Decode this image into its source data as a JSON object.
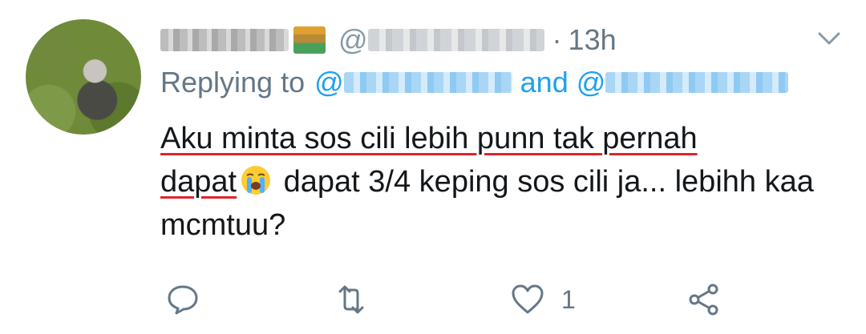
{
  "tweet": {
    "header": {
      "handle_prefix": "@",
      "separator": "·",
      "time": "13h"
    },
    "reply": {
      "prefix": "Replying to",
      "mention_prefix_1": "@",
      "conjunction": "and",
      "mention_prefix_2": "@"
    },
    "body": {
      "underlined_1": "Aku minta sos cili lebih punn tak pernah",
      "underlined_2": "dapat",
      "rest": " dapat 3/4 keping sos cili ja... lebihh kaa mcmtuu?"
    },
    "actions": {
      "like_count": "1"
    }
  },
  "icons": {
    "more": "chevron-down-icon",
    "reply": "reply-icon",
    "retweet": "retweet-icon",
    "like": "heart-icon",
    "share": "share-icon",
    "emoji": "loudly-crying-face-icon"
  },
  "colors": {
    "link": "#1da1f2",
    "muted": "#657786",
    "text": "#14171a",
    "annotation": "#e0242b"
  }
}
